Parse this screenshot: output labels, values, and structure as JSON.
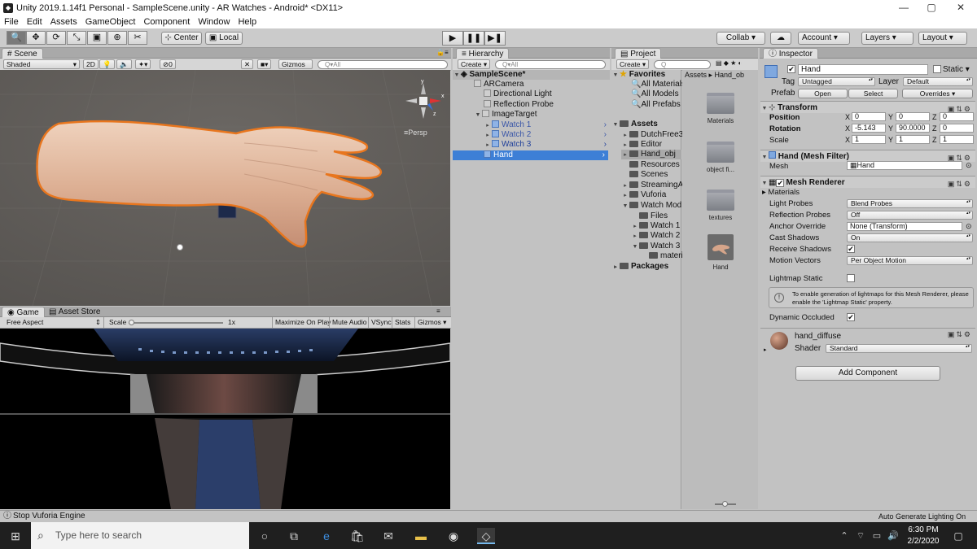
{
  "window": {
    "title": "Unity 2019.1.14f1 Personal - SampleScene.unity - AR Watches - Android* <DX11>",
    "minimize": "—",
    "maximize": "▢",
    "close": "✕"
  },
  "menu": [
    "File",
    "Edit",
    "Assets",
    "GameObject",
    "Component",
    "Window",
    "Help"
  ],
  "toolbar": {
    "tools": [
      "🔍",
      "✥",
      "⟳",
      "⤡",
      "▣",
      "⊕",
      "✂"
    ],
    "center": "Center",
    "local": "Local",
    "play": "▶",
    "pause": "❚❚",
    "step": "▶❚",
    "collab": "Collab ▾",
    "cloud": "☁",
    "account": "Account",
    "layers": "Layers",
    "layout": "Layout"
  },
  "scene": {
    "tab": "# Scene",
    "shading": "Shaded",
    "mode2d": "2D",
    "gizmos": "Gizmos",
    "search": "Q▾All",
    "persp": "≡Persp",
    "audio": "0"
  },
  "game": {
    "tab": "Game",
    "asset_store": "Asset Store",
    "aspect": "Free Aspect",
    "scale_label": "Scale",
    "scale_value": "1x",
    "maximize": "Maximize On Play",
    "mute": "Mute Audio",
    "vsync": "VSync",
    "stats": "Stats",
    "gizmos": "Gizmos"
  },
  "hierarchy": {
    "tab": "Hierarchy",
    "create": "Create ▾",
    "search": "Q▾All",
    "scene": "SampleScene*",
    "items": [
      "ARCamera",
      "Directional Light",
      "Reflection Probe",
      "ImageTarget",
      "Watch 1",
      "Watch 2",
      "Watch 3",
      "Hand"
    ]
  },
  "project": {
    "tab": "Project",
    "create": "Create ▾",
    "favorites": "Favorites",
    "fav_items": [
      "All Materials",
      "All Models",
      "All Prefabs"
    ],
    "assets": "Assets",
    "folders": [
      "DutchFree3",
      "Editor",
      "Hand_obj",
      "Resources",
      "Scenes",
      "StreamingA",
      "Vuforia",
      "Watch Mod",
      "Files",
      "Watch 1",
      "Watch 2",
      "Watch 3",
      "materi"
    ],
    "packages": "Packages",
    "breadcrumb": "Assets ▸ Hand_ob",
    "grid_items": [
      "Materials",
      "object fi...",
      "textures",
      "Hand"
    ]
  },
  "inspector": {
    "tab": "Inspector",
    "name": "Hand",
    "static": "Static ▾",
    "tag_label": "Tag",
    "tag": "Untagged",
    "layer_label": "Layer",
    "layer": "Default",
    "prefab_label": "Prefab",
    "open": "Open",
    "select": "Select",
    "overrides": "Overrides",
    "transform": {
      "title": "Transform",
      "position": "Position",
      "rotation": "Rotation",
      "scale": "Scale",
      "pos": [
        "0",
        "0",
        "0"
      ],
      "rot": [
        "-5.143",
        "90.0000",
        "0"
      ],
      "scl": [
        "1",
        "1",
        "1"
      ],
      "axes": [
        "X",
        "Y",
        "Z"
      ]
    },
    "mesh_filter": {
      "title": "Hand (Mesh Filter)",
      "mesh_label": "Mesh",
      "mesh": "Hand"
    },
    "mesh_renderer": {
      "title": "Mesh Renderer",
      "materials": "Materials",
      "light_probes": "Light Probes",
      "light_probes_v": "Blend Probes",
      "reflection_probes": "Reflection Probes",
      "reflection_probes_v": "Off",
      "anchor": "Anchor Override",
      "anchor_v": "None (Transform)",
      "cast": "Cast Shadows",
      "cast_v": "On",
      "receive": "Receive Shadows",
      "motion": "Motion Vectors",
      "motion_v": "Per Object Motion",
      "lightmap": "Lightmap Static",
      "info": "To enable generation of lightmaps for this Mesh Renderer, please enable the 'Lightmap Static' property.",
      "dynamic": "Dynamic Occluded"
    },
    "material": {
      "name": "hand_diffuse",
      "shader_label": "Shader",
      "shader": "Standard"
    },
    "add_component": "Add Component"
  },
  "status": {
    "left": "Stop Vuforia Engine",
    "right": "Auto Generate Lighting On"
  },
  "taskbar": {
    "search": "Type here to search",
    "time": "6:30 PM",
    "date": "2/2/2020"
  },
  "colors": {
    "selection": "#3d7fd6",
    "orange_outline": "#e8761e",
    "unity_bg": "#c2c2c2",
    "taskbar": "#1f1f1f"
  }
}
